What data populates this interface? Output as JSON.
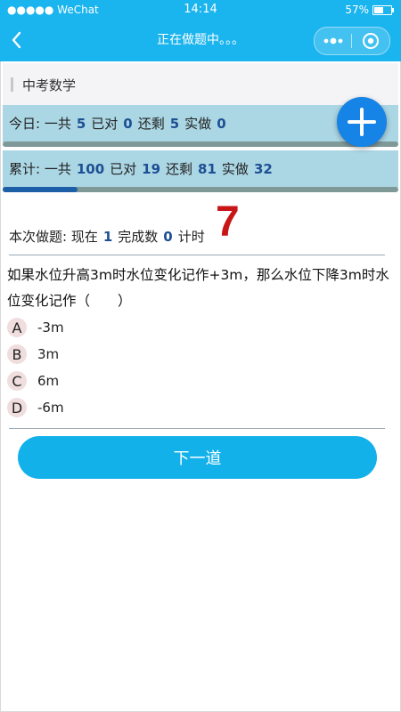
{
  "status_bar": {
    "carrier": "●●●●● WeChat",
    "time": "14:14",
    "battery": "57%",
    "battery_level": 0.57
  },
  "nav": {
    "title": "正在做题中。。。"
  },
  "subject": {
    "label": "中考数学"
  },
  "today": {
    "prefix": "今日: 一共",
    "total": "5",
    "correct_label": "已对",
    "correct": "0",
    "remaining_label": "还剩",
    "remaining": "5",
    "done_label": "实做",
    "done": "0",
    "progress": 0
  },
  "cumulative": {
    "prefix": "累计: 一共",
    "total": "100",
    "correct_label": "已对",
    "correct": "19",
    "remaining_label": "还剩",
    "remaining": "81",
    "done_label": "实做",
    "done": "32",
    "progress": 0.19
  },
  "session": {
    "prefix": "本次做题: 现在",
    "current": "1",
    "completed_label": "完成数",
    "completed": "0",
    "timer_label": "计时",
    "timer": "7"
  },
  "question": {
    "text": "如果水位升高3m时水位变化记作+3m，那么水位下降3m时水位变化记作（　　）",
    "options": [
      {
        "letter": "A",
        "text": "-3m"
      },
      {
        "letter": "B",
        "text": "3m"
      },
      {
        "letter": "C",
        "text": "6m"
      },
      {
        "letter": "D",
        "text": "-6m"
      }
    ]
  },
  "next_button": {
    "label": "下一道"
  },
  "colors": {
    "accent": "#1ab4ee",
    "stat_bg": "#abd6e4",
    "number": "#1d4f94",
    "timer": "#c81515",
    "fab": "#1683e6"
  },
  "icons": {
    "back": "chevron-left-icon",
    "more": "more-dots-icon",
    "close": "target-circle-icon",
    "fab": "plus-icon"
  }
}
